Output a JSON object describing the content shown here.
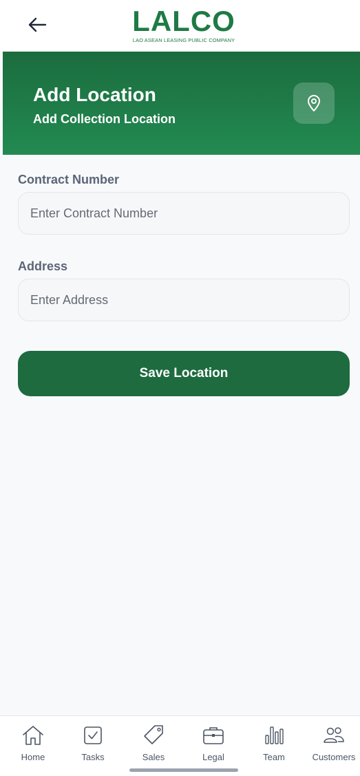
{
  "topbar": {
    "logo_text": "LALCO",
    "logo_subtitle": "LAO ASEAN LEASING PUBLIC COMPANY"
  },
  "header": {
    "title": "Add Location",
    "subtitle": "Add Collection Location"
  },
  "form": {
    "contract_label": "Contract Number",
    "contract_placeholder": "Enter Contract Number",
    "contract_value": "",
    "address_label": "Address",
    "address_placeholder": "Enter Address",
    "address_value": "",
    "save_label": "Save Location"
  },
  "nav": {
    "items": [
      {
        "label": "Home",
        "icon": "home-icon"
      },
      {
        "label": "Tasks",
        "icon": "checkbox-icon"
      },
      {
        "label": "Sales",
        "icon": "tag-icon"
      },
      {
        "label": "Legal",
        "icon": "briefcase-icon"
      },
      {
        "label": "Team",
        "icon": "bar-chart-icon"
      },
      {
        "label": "Customers",
        "icon": "users-icon"
      }
    ]
  },
  "colors": {
    "brand": "#1f7a45",
    "header_top": "#1b6c3e",
    "header_bottom": "#228a51",
    "button": "#1d6b3f"
  }
}
